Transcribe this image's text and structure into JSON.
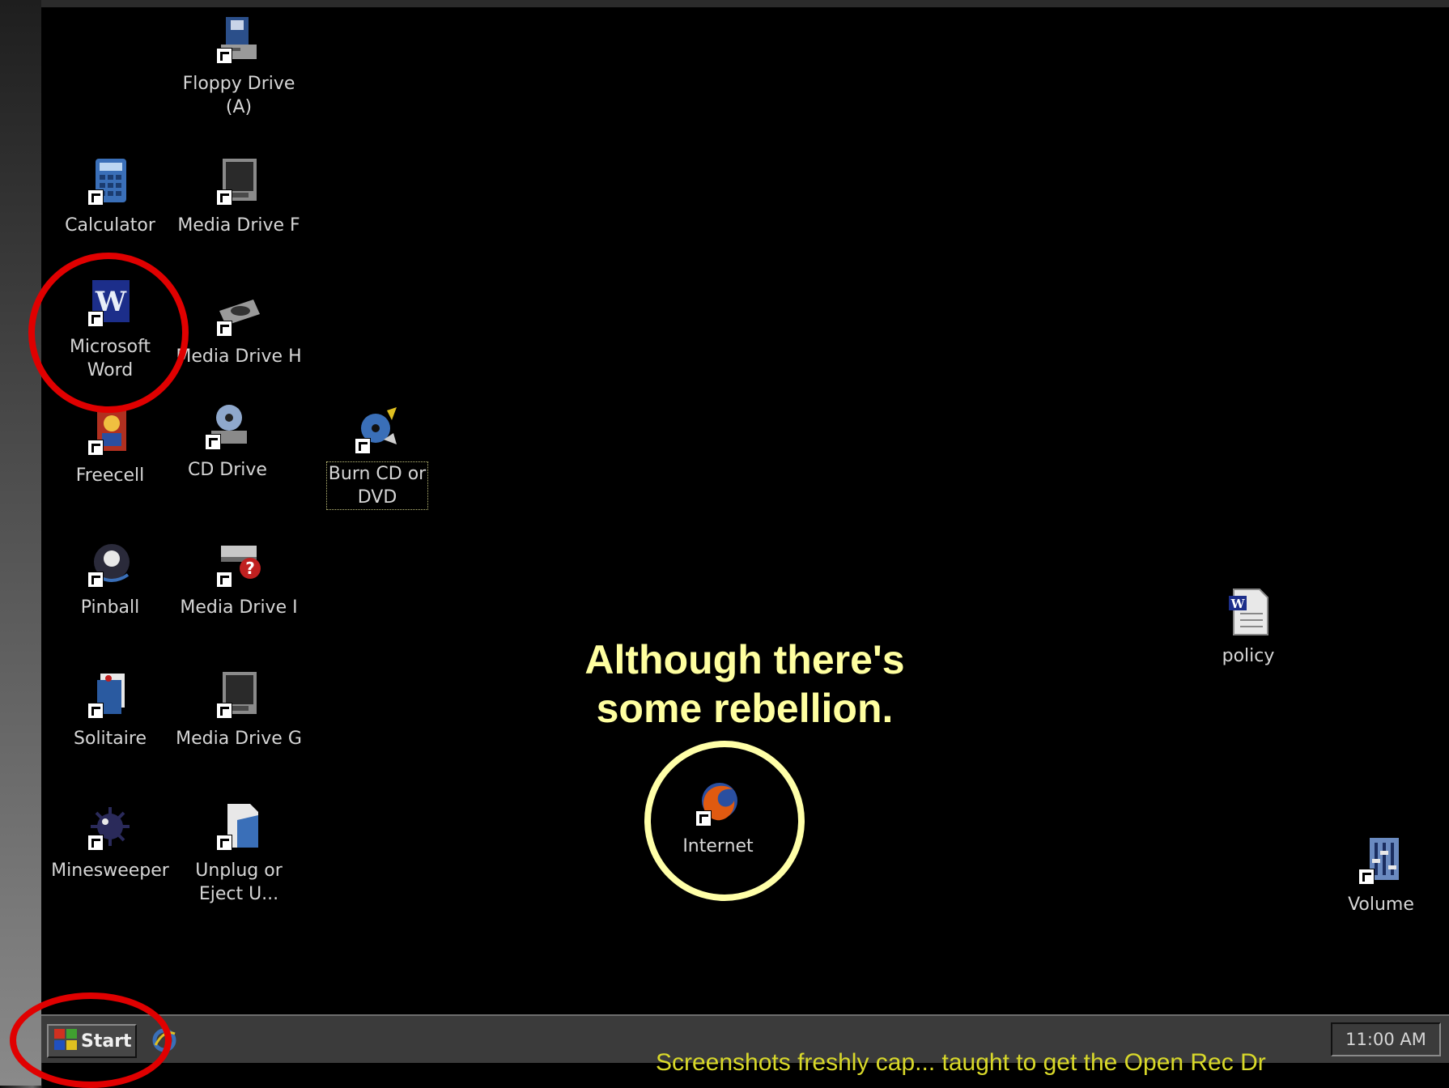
{
  "desktop": {
    "icons": [
      {
        "label": "Floppy Drive\n(A)",
        "icon": "floppy-drive-icon"
      },
      {
        "label": "Calculator",
        "icon": "calculator-icon"
      },
      {
        "label": "Media Drive F",
        "icon": "media-drive-icon"
      },
      {
        "label": "Microsoft\nWord",
        "icon": "word-icon"
      },
      {
        "label": "Media Drive H",
        "icon": "media-drive-icon"
      },
      {
        "label": "Freecell",
        "icon": "freecell-icon"
      },
      {
        "label": "CD Drive",
        "icon": "cd-drive-icon"
      },
      {
        "label": "Burn CD or\nDVD",
        "icon": "burn-cd-icon"
      },
      {
        "label": "Pinball",
        "icon": "pinball-icon"
      },
      {
        "label": "Media Drive I",
        "icon": "media-drive-unknown-icon"
      },
      {
        "label": "Solitaire",
        "icon": "solitaire-icon"
      },
      {
        "label": "Media Drive G",
        "icon": "media-drive-icon"
      },
      {
        "label": "Minesweeper",
        "icon": "minesweeper-icon"
      },
      {
        "label": "Unplug or\nEject U...",
        "icon": "unplug-eject-icon"
      },
      {
        "label": "Internet",
        "icon": "firefox-icon"
      },
      {
        "label": "policy",
        "icon": "word-document-icon"
      },
      {
        "label": "Volume",
        "icon": "volume-icon"
      }
    ]
  },
  "taskbar": {
    "start_label": "Start",
    "clock": "11:00 AM"
  },
  "callout": {
    "text": "Although there's\nsome rebellion."
  },
  "footer": {
    "text": "Screenshots freshly cap... taught to get the Open Rec Dr"
  },
  "colors": {
    "annotation_red": "#e00000",
    "annotation_yellow": "#ffffa8",
    "callout_text": "#ffffa0"
  }
}
